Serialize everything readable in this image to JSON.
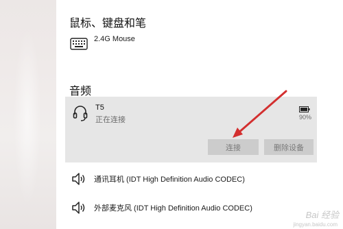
{
  "sections": {
    "mouse_keyboard_title": "鼠标、键盘和笔",
    "audio_title": "音频"
  },
  "devices": {
    "mouse": {
      "name": "2.4G Mouse",
      "icon": "keyboard-icon"
    },
    "t5": {
      "name": "T5",
      "status": "正在连接",
      "battery": "90%",
      "icon": "headset-icon",
      "connect_label": "连接",
      "remove_label": "删除设备"
    },
    "headphones": {
      "name": "通讯耳机 (IDT High Definition Audio CODEC)",
      "icon": "speaker-icon"
    },
    "microphone": {
      "name": "外部麦克风 (IDT High Definition Audio CODEC)",
      "icon": "speaker-icon"
    }
  },
  "watermark": {
    "text": "Bai 经验",
    "sub": "jingyan.baidu.com"
  },
  "colors": {
    "card_bg": "#e6e6e6",
    "button_bg": "#cccccc",
    "arrow": "#d32f2f"
  }
}
